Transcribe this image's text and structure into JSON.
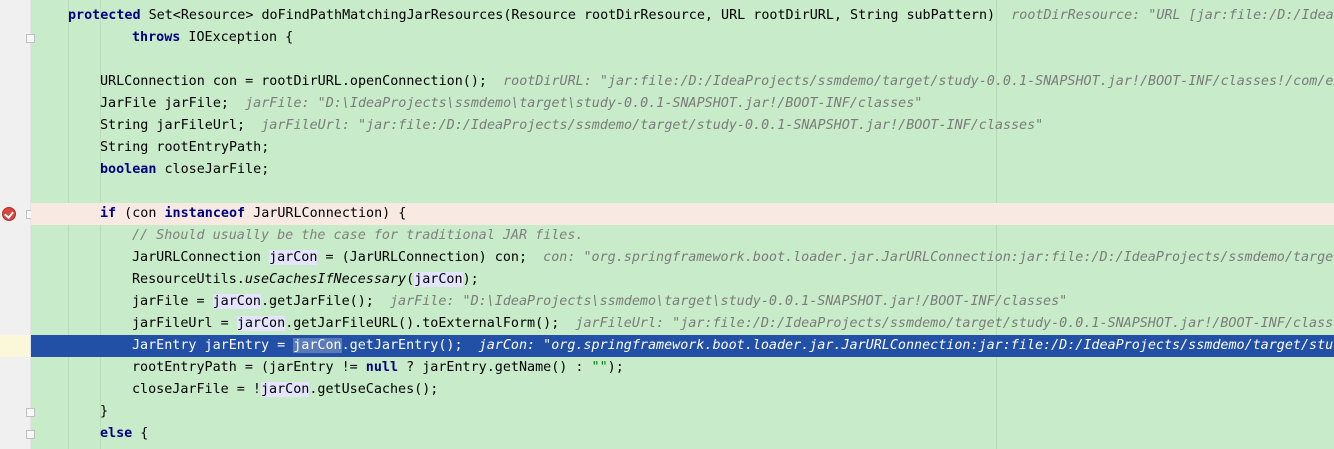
{
  "colors": {
    "editor_background": "#c8ebc9",
    "current_line": "#2150a6",
    "breakpoint_line": "#f8e9e2",
    "keyword": "#000080",
    "inline_hint": "#7b7b7b",
    "comment": "#808080",
    "string": "#067d17",
    "breakpoint_icon": "#d9463f"
  },
  "icons": {
    "breakpoint": "breakpoint-verified-icon",
    "fold": "fold-marker-icon"
  },
  "code": {
    "l1": {
      "kw1": "protected",
      "t1": " Set<Resource> doFindPathMatchingJarResources(Resource rootDirResource, URL rootDirURL, String subPattern)",
      "hint": "  rootDirResource: \"URL [jar:file:/D:/IdeaP"
    },
    "l2": {
      "kw1": "throws",
      "t1": " IOException {"
    },
    "l3": {
      "t1": "URLConnection con = rootDirURL.openConnection();",
      "hint": "  rootDirURL: \"jar:file:/D:/IdeaProjects/ssmdemo/target/study-0.0.1-SNAPSHOT.jar!/BOOT-INF/classes!/com/ex"
    },
    "l4": {
      "t1": "JarFile jarFile;",
      "hint": "  jarFile: \"D:\\IdeaProjects\\ssmdemo\\target\\study-0.0.1-SNAPSHOT.jar!/BOOT-INF/classes\""
    },
    "l5": {
      "t1": "String jarFileUrl;",
      "hint": "  jarFileUrl: \"jar:file:/D:/IdeaProjects/ssmdemo/target/study-0.0.1-SNAPSHOT.jar!/BOOT-INF/classes\""
    },
    "l6": {
      "t1": "String rootEntryPath;"
    },
    "l7": {
      "kw1": "boolean",
      "t1": " closeJarFile;"
    },
    "l8": {
      "kw1": "if",
      "t1": " (con ",
      "kw2": "instanceof",
      "t2": " JarURLConnection) {"
    },
    "l9": {
      "comment": "// Should usually be the case for traditional JAR files."
    },
    "l10": {
      "t1": "JarURLConnection ",
      "v1": "jarCon",
      "t2": " = (JarURLConnection) con;",
      "hint": "  con: \"org.springframework.boot.loader.jar.JarURLConnection:jar:file:/D:/IdeaProjects/ssmdemo/target"
    },
    "l11": {
      "t1": "ResourceUtils.",
      "italic": "useCachesIfNecessary",
      "t2": "(",
      "v1": "jarCon",
      "t3": ");"
    },
    "l12": {
      "t1": "jarFile = ",
      "v1": "jarCon",
      "t2": ".getJarFile();",
      "hint": "  jarFile: \"D:\\IdeaProjects\\ssmdemo\\target\\study-0.0.1-SNAPSHOT.jar!/BOOT-INF/classes\""
    },
    "l13": {
      "t1": "jarFileUrl = ",
      "v1": "jarCon",
      "t2": ".getJarFileURL().toExternalForm();",
      "hint": "  jarFileUrl: \"jar:file:/D:/IdeaProjects/ssmdemo/target/study-0.0.1-SNAPSHOT.jar!/BOOT-INF/classe"
    },
    "l14": {
      "t1": "JarEntry jarEntry = ",
      "v1": "jarCon",
      "t2": ".getJarEntry();",
      "hint": "  jarCon: \"org.springframework.boot.loader.jar.JarURLConnection:jar:file:/D:/IdeaProjects/ssmdemo/target/stud"
    },
    "l15": {
      "t1": "rootEntryPath = (jarEntry != ",
      "kw1": "null",
      "t2": " ? jarEntry.getName() : ",
      "str": "\"\"",
      "t3": ");"
    },
    "l16": {
      "t1": "closeJarFile = !",
      "v1": "jarCon",
      "t2": ".getUseCaches();"
    },
    "l17": {
      "t1": "}"
    },
    "l18": {
      "kw1": "else",
      "t1": " {"
    }
  }
}
